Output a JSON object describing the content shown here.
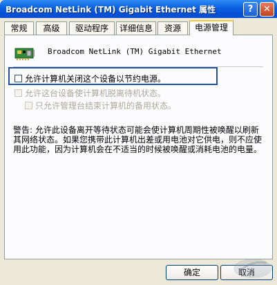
{
  "window": {
    "title": "Broadcom NetLink (TM) Gigabit Ethernet 属性"
  },
  "titlebar": {
    "help_glyph": "?",
    "close_glyph": "✕"
  },
  "tabs": [
    {
      "label": "常规"
    },
    {
      "label": "高级"
    },
    {
      "label": "驱动程序"
    },
    {
      "label": "详细信息"
    },
    {
      "label": "资源"
    },
    {
      "label": "电源管理",
      "active": true
    }
  ],
  "device": {
    "icon": "network-adapter-icon",
    "name": "Broadcom NetLink (TM) Gigabit Ethernet"
  },
  "options": [
    {
      "label": "允许计算机关闭这个设备以节约电源。",
      "checked": false,
      "enabled": true
    },
    {
      "label": "允许这台设备使计算机脱离待机状态。",
      "checked": false,
      "enabled": false
    },
    {
      "label": "只允许管理台结束计算机的备用状态。",
      "checked": false,
      "enabled": false
    }
  ],
  "warning_text": "警告: 允许此设备离开等待状态可能会使计算机周期性被唤醒以刷新其网络状态。如果您携带此计算机出差或用电池对它供电，则不应使用此功能，因为计算机会在不适当的时候被唤醒或消耗电池的电量。",
  "footer": {
    "ok_label": "确定",
    "cancel_label": "取消"
  },
  "colors": {
    "title_blue": "#0a5fe0",
    "highlight_border": "#1f4fa8",
    "active_tab_accent": "#ffc83c"
  }
}
